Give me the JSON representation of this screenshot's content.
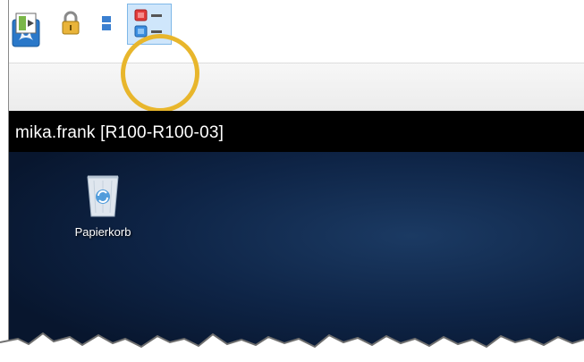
{
  "session": {
    "title": "mika.frank [R100-R100-03]"
  },
  "desktop": {
    "icons": [
      {
        "label": "Papierkorb"
      }
    ]
  }
}
